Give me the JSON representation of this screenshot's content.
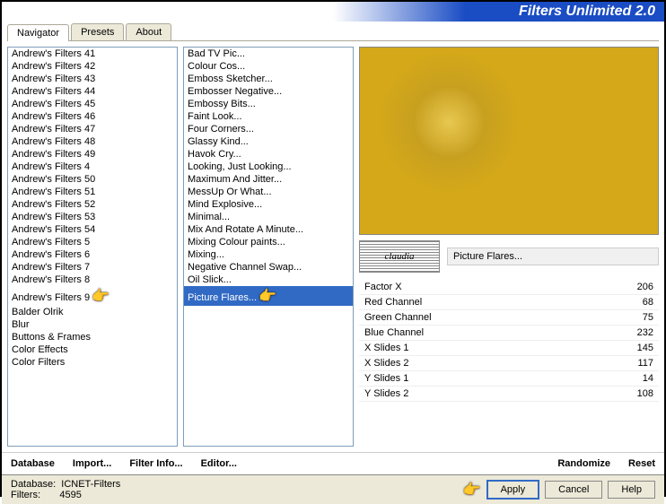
{
  "header": {
    "title": "Filters Unlimited 2.0"
  },
  "tabs": [
    "Navigator",
    "Presets",
    "About"
  ],
  "active_tab": 0,
  "categories": [
    "Andrew's Filters 41",
    "Andrew's Filters 42",
    "Andrew's Filters 43",
    "Andrew's Filters 44",
    "Andrew's Filters 45",
    "Andrew's Filters 46",
    "Andrew's Filters 47",
    "Andrew's Filters 48",
    "Andrew's Filters 49",
    "Andrew's Filters 4",
    "Andrew's Filters 50",
    "Andrew's Filters 51",
    "Andrew's Filters 52",
    "Andrew's Filters 53",
    "Andrew's Filters 54",
    "Andrew's Filters 5",
    "Andrew's Filters 6",
    "Andrew's Filters 7",
    "Andrew's Filters 8",
    "Andrew's Filters 9",
    "Balder Olrik",
    "Blur",
    "Buttons & Frames",
    "Color Effects",
    "Color Filters"
  ],
  "category_pointer_index": 19,
  "filters": [
    "Bad TV Pic...",
    "Colour Cos...",
    "Emboss Sketcher...",
    "Embosser Negative...",
    "Embossy Bits...",
    "Faint Look...",
    "Four Corners...",
    "Glassy Kind...",
    "Havok Cry...",
    "Looking, Just Looking...",
    "Maximum And Jitter...",
    "MessUp Or What...",
    "Mind Explosive...",
    "Minimal...",
    "Mix And Rotate A Minute...",
    "Mixing Colour paints...",
    "Mixing...",
    "Negative Channel Swap...",
    "Oil Slick...",
    "Picture Flares..."
  ],
  "filter_selected_index": 19,
  "current_filter": "Picture Flares...",
  "logo_text": "claudia",
  "params": [
    {
      "label": "Factor X",
      "value": "206"
    },
    {
      "label": "Red Channel",
      "value": "68"
    },
    {
      "label": "Green Channel",
      "value": "75"
    },
    {
      "label": "Blue Channel",
      "value": "232"
    },
    {
      "label": "X Slides 1",
      "value": "145"
    },
    {
      "label": "X Slides 2",
      "value": "117"
    },
    {
      "label": "Y Slides 1",
      "value": "14"
    },
    {
      "label": "Y Slides 2",
      "value": "108"
    }
  ],
  "bottom": {
    "database": "Database",
    "import": "Import...",
    "filter_info": "Filter Info...",
    "editor": "Editor...",
    "randomize": "Randomize",
    "reset": "Reset"
  },
  "status": {
    "db_label": "Database:",
    "db_value": "ICNET-Filters",
    "filters_label": "Filters:",
    "filters_value": "4595"
  },
  "buttons": {
    "apply": "Apply",
    "cancel": "Cancel",
    "help": "Help"
  }
}
